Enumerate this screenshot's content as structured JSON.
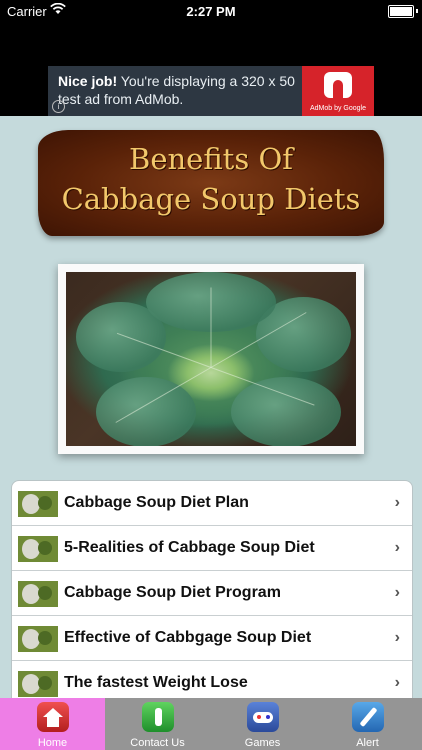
{
  "status_bar": {
    "carrier": "Carrier",
    "time": "2:27 PM"
  },
  "ad": {
    "headline": "Nice job!",
    "body": "You're displaying a 320 x 50 test ad from AdMob.",
    "brand": "AdMob by Google",
    "info_glyph": "i"
  },
  "banner": {
    "line1": "Benefits Of",
    "line2": "Cabbage Soup Diets"
  },
  "menu": {
    "items": [
      {
        "label": "Cabbage Soup Diet Plan"
      },
      {
        "label": "5-Realities of Cabbage Soup Diet"
      },
      {
        "label": "Cabbage Soup Diet Program"
      },
      {
        "label": "Effective of Cabbgage Soup Diet"
      },
      {
        "label": "The fastest Weight Lose"
      }
    ],
    "chevron": "›"
  },
  "tabbar": {
    "tabs": [
      {
        "label": "Home",
        "icon": "home-icon",
        "active": true
      },
      {
        "label": "Contact Us",
        "icon": "touch-icon",
        "active": false
      },
      {
        "label": "Games",
        "icon": "gamepad-icon",
        "active": false
      },
      {
        "label": "Alert",
        "icon": "pen-icon",
        "active": false
      }
    ],
    "active_color": "#ee7ee6"
  }
}
